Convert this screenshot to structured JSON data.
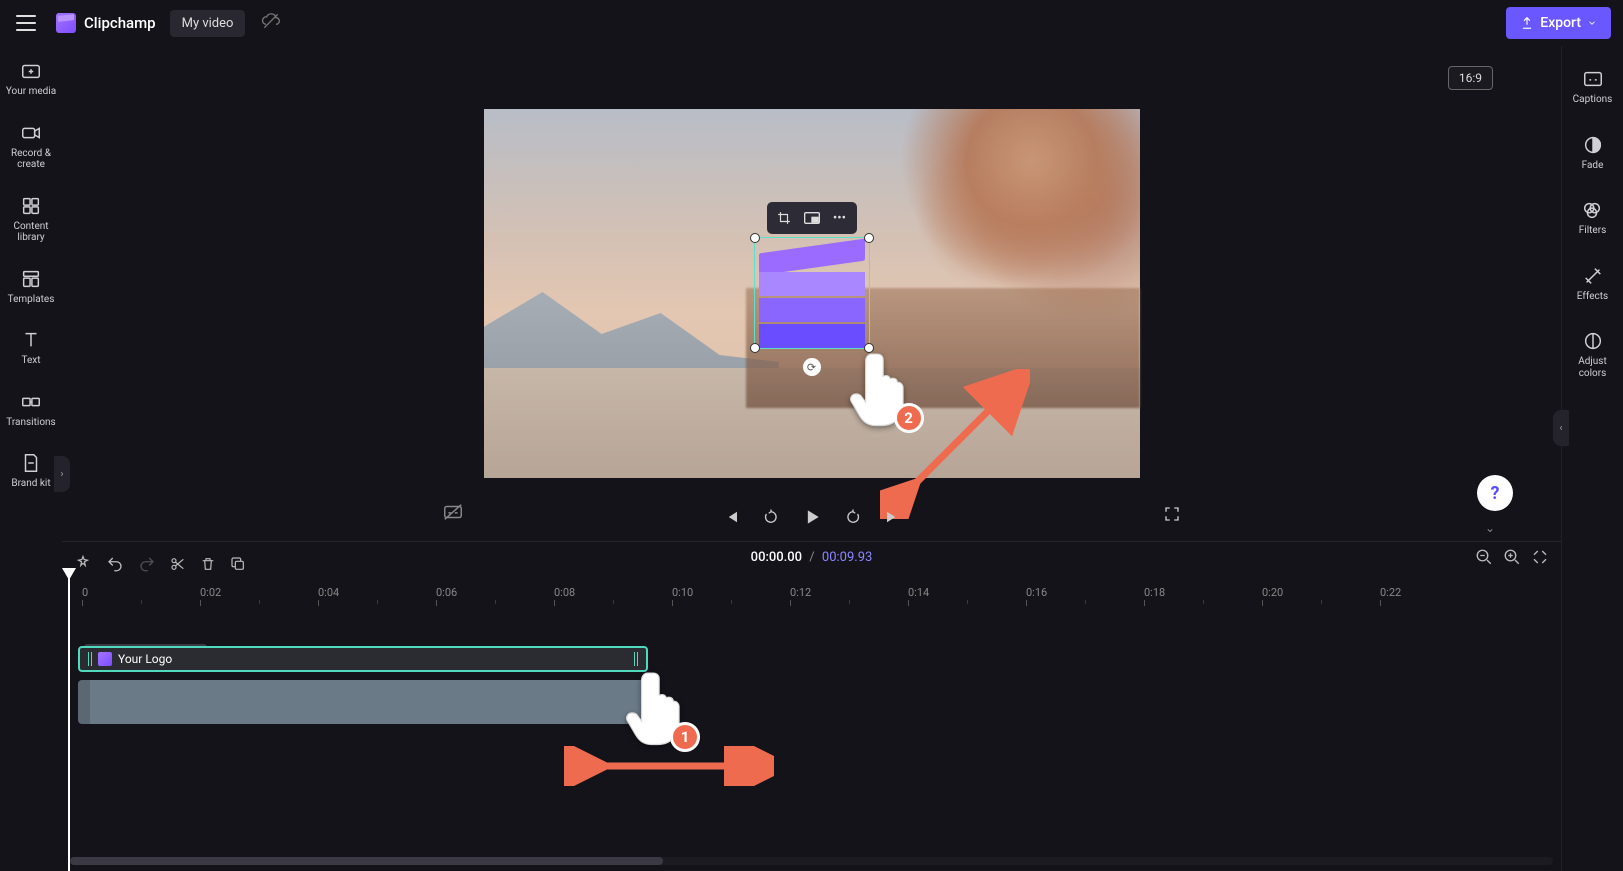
{
  "header": {
    "app_name": "Clipchamp",
    "project_name": "My video",
    "export_label": "Export"
  },
  "left_rail": {
    "items": [
      {
        "label": "Your media"
      },
      {
        "label": "Record & create"
      },
      {
        "label": "Content library"
      },
      {
        "label": "Templates"
      },
      {
        "label": "Text"
      },
      {
        "label": "Transitions"
      },
      {
        "label": "Brand kit"
      }
    ]
  },
  "right_rail": {
    "items": [
      {
        "label": "Captions"
      },
      {
        "label": "Fade"
      },
      {
        "label": "Filters"
      },
      {
        "label": "Effects"
      },
      {
        "label": "Adjust colors"
      }
    ]
  },
  "preview": {
    "aspect_ratio": "16:9",
    "overlay_toolbar": {
      "crop": "crop",
      "pip": "picture-in-picture",
      "more": "more"
    }
  },
  "annotations": {
    "step1": "1",
    "step2": "2"
  },
  "playback": {
    "current_time": "00:00.00",
    "separator": "/",
    "duration": "00:09.93"
  },
  "timeline": {
    "clip_tooltip": "Clipchamp_icon.svg",
    "logo_clip_label": "Your Logo",
    "ruler_marks": [
      "0",
      "0:02",
      "0:04",
      "0:06",
      "0:08",
      "0:10",
      "0:12",
      "0:14",
      "0:16",
      "0:18",
      "0:20",
      "0:22"
    ]
  },
  "help": {
    "label": "?"
  }
}
